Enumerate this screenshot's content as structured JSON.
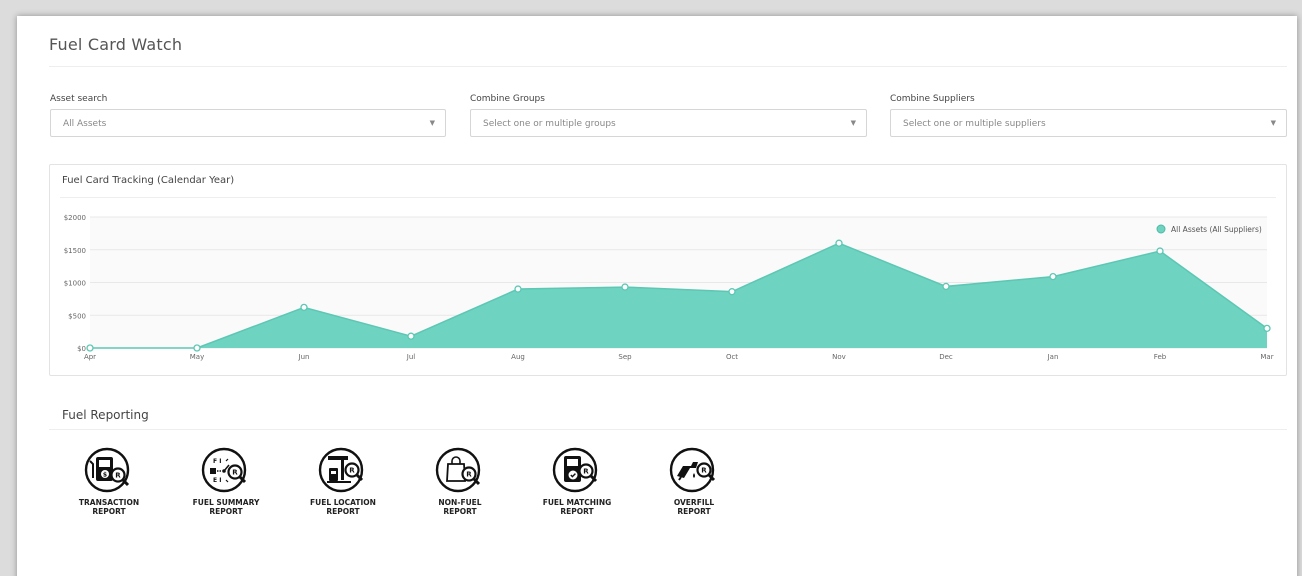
{
  "page": {
    "title": "Fuel Card Watch"
  },
  "filters": {
    "asset_search": {
      "label": "Asset search",
      "value": "All Assets"
    },
    "combine_groups": {
      "label": "Combine Groups",
      "placeholder": "Select one or multiple groups"
    },
    "combine_suppliers": {
      "label": "Combine Suppliers",
      "placeholder": "Select one or multiple suppliers"
    }
  },
  "chart_panel": {
    "title": "Fuel Card Tracking (Calendar Year)"
  },
  "chart_data": {
    "type": "area",
    "title": "Fuel Card Tracking (Calendar Year)",
    "xlabel": "",
    "ylabel": "",
    "categories": [
      "Apr",
      "May",
      "Jun",
      "Jul",
      "Aug",
      "Sep",
      "Oct",
      "Nov",
      "Dec",
      "Jan",
      "Feb",
      "Mar"
    ],
    "series": [
      {
        "name": "All Assets (All Suppliers)",
        "values": [
          0,
          0,
          620,
          180,
          900,
          930,
          860,
          1600,
          940,
          1090,
          1480,
          300
        ]
      }
    ],
    "ylim": [
      0,
      2000
    ],
    "yticks": [
      "$0",
      "$500",
      "$1000",
      "$1500",
      "$2000"
    ],
    "grid": true,
    "legend_position": "top-right",
    "color": "#6fd3c1"
  },
  "reporting": {
    "title": "Fuel Reporting",
    "items": [
      {
        "label": "TRANSACTION\nREPORT",
        "icon": "transaction-report-icon"
      },
      {
        "label": "FUEL SUMMARY\nREPORT",
        "icon": "fuel-summary-report-icon"
      },
      {
        "label": "FUEL LOCATION\nREPORT",
        "icon": "fuel-location-report-icon"
      },
      {
        "label": "NON-FUEL\nREPORT",
        "icon": "non-fuel-report-icon"
      },
      {
        "label": "FUEL MATCHING\nREPORT",
        "icon": "fuel-matching-report-icon"
      },
      {
        "label": "OVERFILL\nREPORT",
        "icon": "overfill-report-icon"
      }
    ]
  }
}
